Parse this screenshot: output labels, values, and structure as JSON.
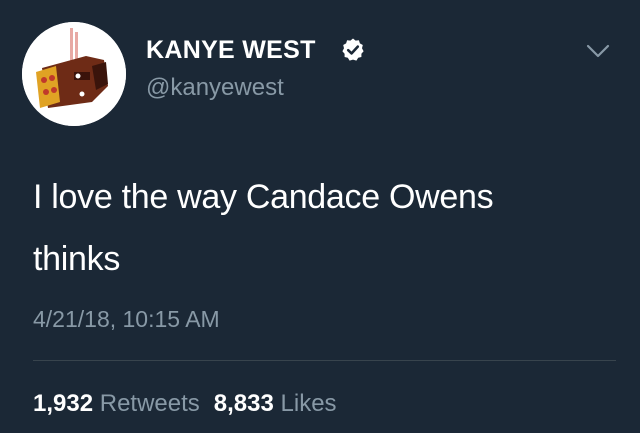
{
  "tweet": {
    "author": {
      "display_name": "KANYE WEST",
      "handle": "@kanyewest",
      "verified": true,
      "avatar_icon": "avatar-image"
    },
    "text_line1": "I love the way Candace Owens",
    "text_line2": "thinks",
    "timestamp": "4/21/18, 10:15 AM",
    "stats": {
      "retweets_count": "1,932",
      "retweets_label": "Retweets",
      "likes_count": "8,833",
      "likes_label": "Likes"
    },
    "menu_icon": "chevron-down-icon"
  },
  "colors": {
    "background": "#1b2836",
    "text_primary": "#ffffff",
    "text_secondary": "#8899a6",
    "divider": "#38444d"
  }
}
